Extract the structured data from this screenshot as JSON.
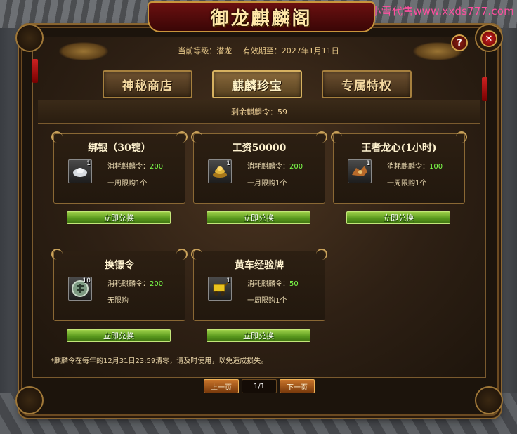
{
  "watermark": "小雪代售www.xxds777.com",
  "window": {
    "title": "御龙麒麟阁",
    "help_label": "?",
    "close_label": "✕"
  },
  "info": {
    "level_label": "当前等级：潜龙",
    "expiry_label": "有效期至：2027年1月11日"
  },
  "tabs": [
    {
      "label": "神秘商店",
      "active": false
    },
    {
      "label": "麒麟珍宝",
      "active": true
    },
    {
      "label": "专属特权",
      "active": false
    }
  ],
  "remaining": "剩余麒麟令：59",
  "cost_prefix": "消耗麒麟令：",
  "items": [
    {
      "name": "绑银（30锭）",
      "icon": "silver-ingot-icon",
      "count": "1",
      "cost": "200",
      "limit": "一周限购1个",
      "button": "立即兑换"
    },
    {
      "name": "工资50000",
      "icon": "gold-pile-icon",
      "count": "1",
      "cost": "200",
      "limit": "一月限购1个",
      "button": "立即兑换"
    },
    {
      "name": "王者龙心(1小时)",
      "icon": "dragon-heart-icon",
      "count": "1",
      "cost": "100",
      "limit": "一周限购1个",
      "button": "立即兑换"
    },
    {
      "name": "换镖令",
      "icon": "escort-token-icon",
      "count": "10",
      "cost": "200",
      "limit": "无限购",
      "button": "立即兑换"
    },
    {
      "name": "黄车经验牌",
      "icon": "yellow-cart-exp-icon",
      "count": "1",
      "cost": "50",
      "limit": "一周限购1个",
      "button": "立即兑换"
    }
  ],
  "notice": "*麒麟令在每年的12月31日23:59清零，请及时使用，以免造成损失。",
  "pager": {
    "prev_label": "上一页",
    "page_label": "1/1",
    "next_label": "下一页"
  }
}
